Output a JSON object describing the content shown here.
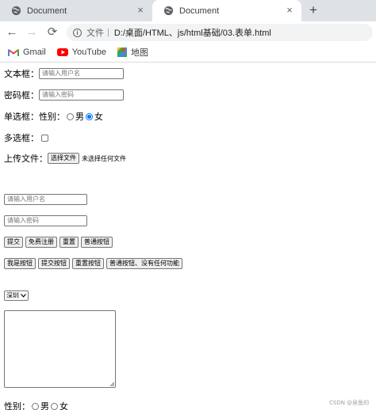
{
  "tabs": [
    {
      "label": "Document",
      "active": false
    },
    {
      "label": "Document",
      "active": true
    }
  ],
  "tab_close_glyph": "×",
  "new_tab_glyph": "+",
  "toolbar": {
    "back_glyph": "←",
    "forward_glyph": "→",
    "reload_glyph": "⟳",
    "origin_label": "文件",
    "separator": "|",
    "url": "D:/桌面/HTML、js/html基础/03.表单.html"
  },
  "bookmarks": [
    {
      "label": "Gmail",
      "icon": "gmail-icon"
    },
    {
      "label": "YouTube",
      "icon": "youtube-icon"
    },
    {
      "label": "地图",
      "icon": "maps-icon"
    }
  ],
  "form": {
    "text_label": "文本框：",
    "text_placeholder": "请输入用户名",
    "password_label": "密码框：",
    "password_placeholder": "请输入密码",
    "radio_label": "单选框：",
    "gender_label": "性别：",
    "male": "男",
    "female": "女",
    "checkbox_label": "多选框：",
    "file_label": "上传文件：",
    "file_button": "选择文件",
    "file_status": "未选择任何文件",
    "username_placeholder": "请输入用户名",
    "password2_placeholder": "请输入密码",
    "buttons_row1": [
      "提交",
      "免费注册",
      "重置",
      "普通按钮"
    ],
    "buttons_row2": [
      "我是按钮",
      "提交按钮",
      "重置按钮",
      "普通按钮、没有任何功能"
    ],
    "select_value": "深圳",
    "gender2_label": "性别：",
    "male2": "男",
    "female2": "女"
  },
  "radio_selected": "female",
  "radio2_selected": "none",
  "watermark": "CSDN @吴鱼的"
}
